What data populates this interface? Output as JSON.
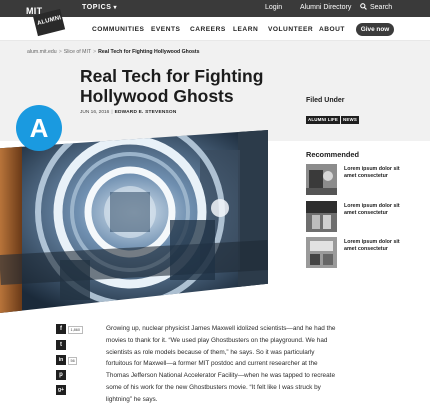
{
  "topbar": {
    "logo_top": "MIT",
    "logo_bottom": "ALUMNI",
    "topics_label": "TOPICS",
    "login_label": "Login",
    "directory_label": "Alumni Directory",
    "search_label": "Search"
  },
  "nav": {
    "items": [
      "COMMUNITIES",
      "EVENTS",
      "CAREERS",
      "LEARN",
      "VOLUNTEER",
      "ABOUT"
    ],
    "give_label": "Give now"
  },
  "breadcrumb": {
    "items": [
      "alum.mit.edu",
      "Slice of MIT"
    ],
    "current": "Real Tech for Fighting Hollywood Ghosts"
  },
  "article": {
    "badge_letter": "A",
    "title": "Real Tech for Fighting Hollywood Ghosts",
    "date": "JUN 16, 2016",
    "author": "EDWARD E. STEVENSON",
    "body": "Growing up, nuclear physicist James Maxwell idolized scientists—and he had the movies to thank for it. “We used play Ghostbusters on the playground. We had scientists as role models because of them,” he says. So it was particularly fortuitous for Maxwell—a former MIT postdoc and current researcher at the Thomas Jefferson National Accelerator Facility—when he was tapped to recreate some of his work for the new Ghostbusters movie. “It felt like I was struck by lightning” he says."
  },
  "filed_under": {
    "heading": "Filed Under",
    "tags": [
      "ALUMNI LIFE",
      "NEWS"
    ]
  },
  "recommended": {
    "heading": "Recommended",
    "items": [
      {
        "text": "Lorem ipsum dolor sit amet consectetur"
      },
      {
        "text": "Lorem ipsum dolor sit amet consectetur"
      },
      {
        "text": "Lorem ipsum dolor sit amet consectetur"
      }
    ]
  },
  "share": {
    "facebook_icon": "f",
    "facebook_count": "1,860",
    "twitter_icon": "t",
    "linkedin_icon": "in",
    "linkedin_count": "56",
    "pinterest_icon": "p",
    "googleplus_icon": "g+"
  },
  "colors": {
    "badge": "#1a9ae0",
    "topbar": "#3a3a3a",
    "band": "#f1f1f1"
  }
}
